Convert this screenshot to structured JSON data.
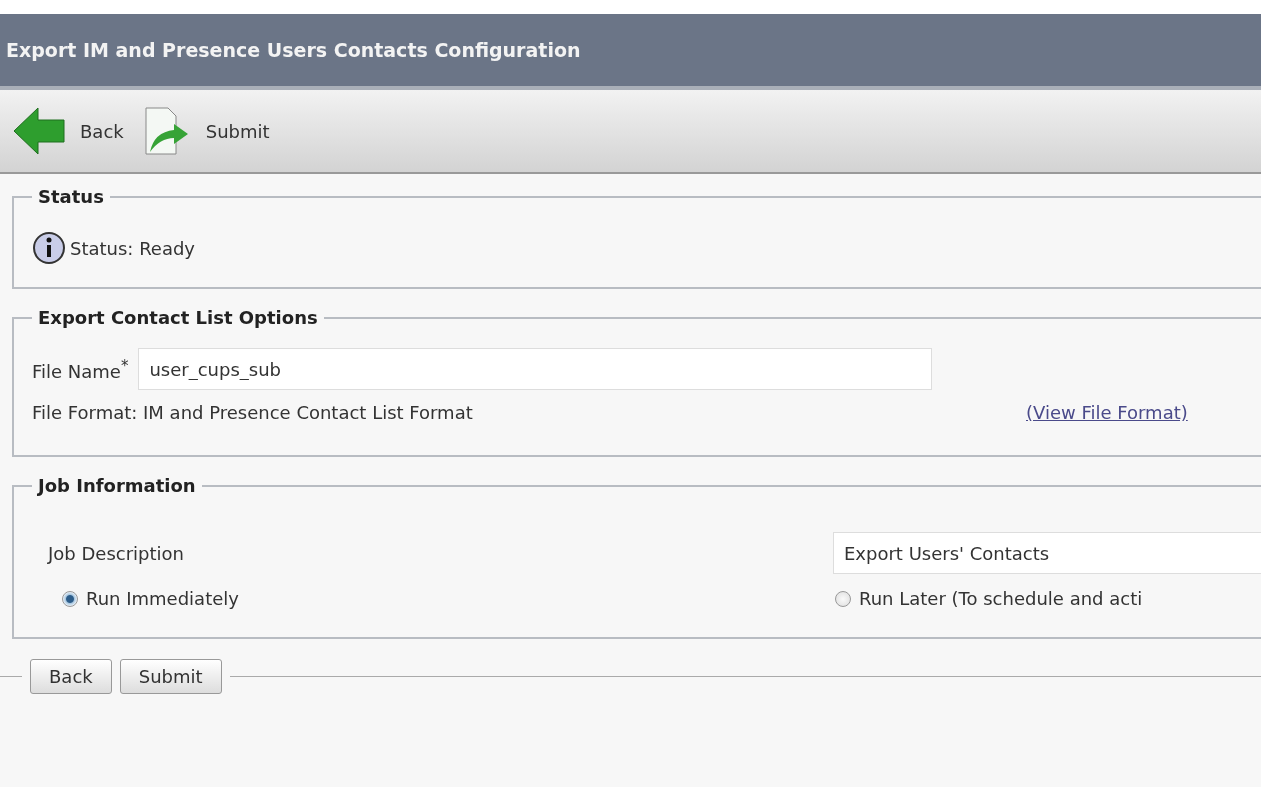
{
  "title": "Export IM and Presence Users Contacts Configuration",
  "toolbar": [
    {
      "kind": "back",
      "label": "Back"
    },
    {
      "kind": "submit",
      "label": "Submit"
    }
  ],
  "status_section": {
    "legend": "Status",
    "message": "Status: Ready"
  },
  "options_section": {
    "legend": "Export Contact List Options",
    "file_name_label": "File Name",
    "required_mark": "*",
    "file_name_value": "user_cups_sub",
    "file_format": "File Format: IM and Presence Contact List Format",
    "view_link": "(View File Format)"
  },
  "job_section": {
    "legend": "Job Information",
    "description_label": "Job Description",
    "description_value": "Export Users' Contacts",
    "run_options": [
      {
        "label": "Run Immediately",
        "selected": true
      },
      {
        "label": "Run Later (To schedule and acti",
        "selected": false
      }
    ]
  },
  "bottom_buttons": [
    "Back",
    "Submit"
  ]
}
